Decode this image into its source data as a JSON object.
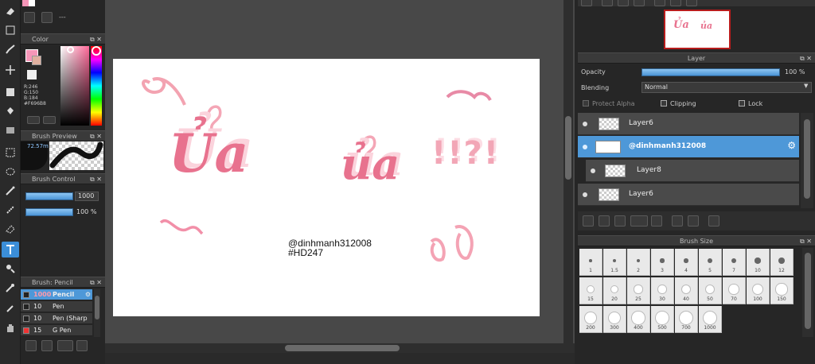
{
  "color_panel": {
    "title": "Color",
    "r": "R:246",
    "g": "G:150",
    "b": "B:184",
    "hex": "#F696B8",
    "main_color": "#f696b8"
  },
  "brush_preview": {
    "title": "Brush Preview",
    "size_readout": "72.57m"
  },
  "brush_control": {
    "title": "Brush Control",
    "size_value": "1000",
    "opacity_value": "100 %"
  },
  "brush_panel": {
    "title": "Brush: Pencil",
    "items": [
      {
        "size": "1000",
        "name": "Pencil",
        "selected": true
      },
      {
        "size": "10",
        "name": "Pen"
      },
      {
        "size": "10",
        "name": "Pen (Sharp"
      },
      {
        "size": "15",
        "name": "G Pen"
      }
    ]
  },
  "top_swatch_text": "---",
  "layer_panel": {
    "title": "Layer",
    "opacity_label": "Opacity",
    "opacity_value": "100 %",
    "opacity_fraction": 1.0,
    "blending_label": "Blending",
    "blending_value": "Normal",
    "protect_alpha": "Protect Alpha",
    "clipping": "Clipping",
    "lock": "Lock",
    "layers": [
      {
        "name": "Layer6",
        "selected": false
      },
      {
        "name": "@dinhmanh312008",
        "selected": true
      },
      {
        "name": "Layer8",
        "selected": false
      },
      {
        "name": "Layer6",
        "selected": false
      }
    ]
  },
  "brush_size_panel": {
    "title": "Brush Size",
    "sizes": [
      "1",
      "1.5",
      "2",
      "3",
      "4",
      "5",
      "7",
      "10",
      "12",
      "15",
      "20",
      "25",
      "30",
      "40",
      "50",
      "70",
      "100",
      "150",
      "200",
      "300",
      "400",
      "500",
      "700",
      "1000"
    ]
  },
  "canvas": {
    "title_left": "Ủa",
    "title_right": "ủa",
    "exclaims": "!!?!",
    "watermark_line1": "@dinhmanh312008",
    "watermark_line2": "#HD247"
  },
  "colors": {
    "accent": "#4e98d8",
    "pink": "#f696b8",
    "pink_dark": "#d05a78"
  }
}
